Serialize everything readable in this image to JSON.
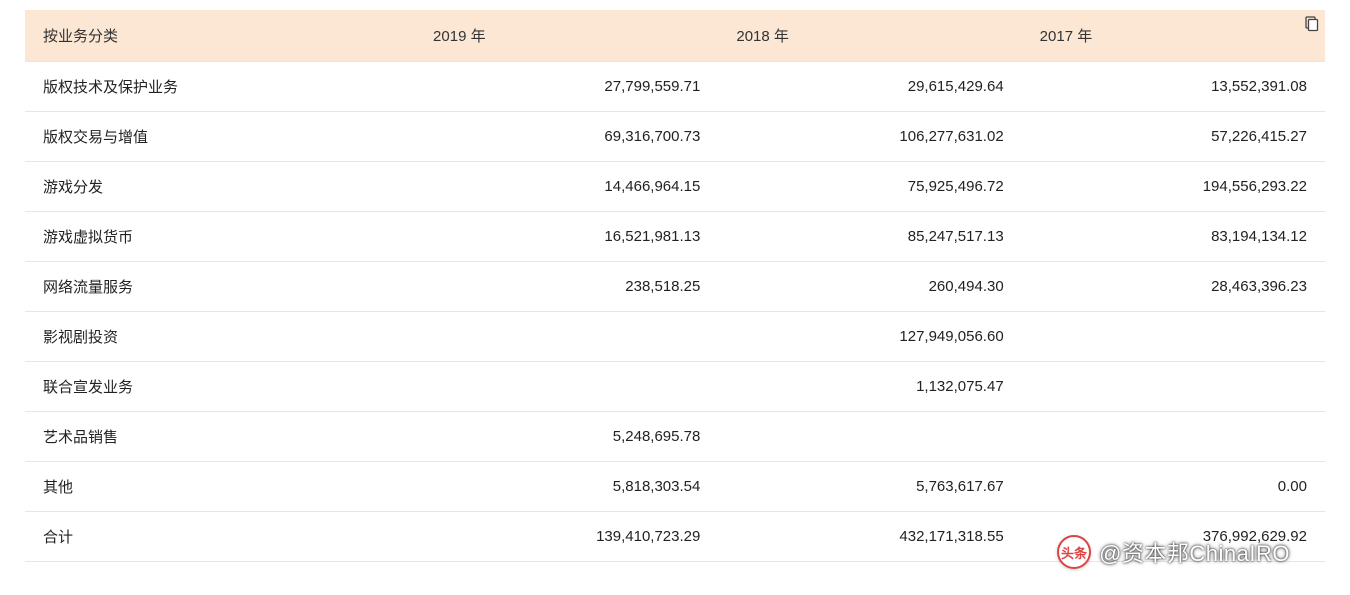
{
  "chart_data": {
    "type": "table",
    "title": "",
    "columns": [
      "按业务分类",
      "2019 年",
      "2018 年",
      "2017 年"
    ],
    "rows": [
      [
        "版权技术及保护业务",
        "27,799,559.71",
        "29,615,429.64",
        "13,552,391.08"
      ],
      [
        "版权交易与增值",
        "69,316,700.73",
        "106,277,631.02",
        "57,226,415.27"
      ],
      [
        "游戏分发",
        "14,466,964.15",
        "75,925,496.72",
        "194,556,293.22"
      ],
      [
        "游戏虚拟货币",
        "16,521,981.13",
        "85,247,517.13",
        "83,194,134.12"
      ],
      [
        "网络流量服务",
        "238,518.25",
        "260,494.30",
        "28,463,396.23"
      ],
      [
        "影视剧投资",
        "",
        "127,949,056.60",
        ""
      ],
      [
        "联合宣发业务",
        "",
        "1,132,075.47",
        ""
      ],
      [
        "艺术品销售",
        "5,248,695.78",
        "",
        ""
      ],
      [
        "其他",
        "5,818,303.54",
        "5,763,617.67",
        "0.00"
      ],
      [
        "合计",
        "139,410,723.29",
        "432,171,318.55",
        "376,992,629.92"
      ]
    ]
  },
  "watermark": {
    "badge": "头条",
    "text": "@资本邦ChinaIRO"
  }
}
